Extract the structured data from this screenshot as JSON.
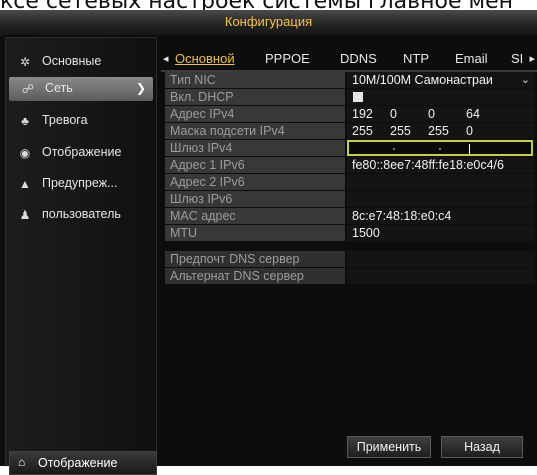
{
  "caption": "ксе сетевых настроек системы главное мен",
  "window": {
    "title": "Конфигурация"
  },
  "sidebar": {
    "items": [
      {
        "icon": "gear-icon",
        "glyph": "✲",
        "label": "Основные"
      },
      {
        "icon": "network-icon",
        "glyph": "☍",
        "label": "Сеть",
        "active": true
      },
      {
        "icon": "alarm-icon",
        "glyph": "♣",
        "label": "Тревога"
      },
      {
        "icon": "eye-icon",
        "glyph": "◉",
        "label": "Отображение"
      },
      {
        "icon": "warning-icon",
        "glyph": "▲",
        "label": "Предупреж..."
      },
      {
        "icon": "users-icon",
        "glyph": "♟",
        "label": "пользователь"
      }
    ],
    "bottom": {
      "icon": "home-icon",
      "glyph": "⌂",
      "label": "Отображение"
    }
  },
  "tabs": [
    "Основной",
    "PPPOE",
    "DDNS",
    "NTP",
    "Email",
    "SI"
  ],
  "form": {
    "nic_type": {
      "label": "Тип NIC",
      "value": "10M/100M Самонастраи"
    },
    "dhcp": {
      "label": "Вкл. DHCP"
    },
    "ipv4": {
      "label": "Адрес IPv4",
      "octets": [
        "192",
        "0",
        "0",
        "64"
      ]
    },
    "mask": {
      "label": "Маска подсети IPv4",
      "octets": [
        "255",
        "255",
        "255",
        "0"
      ]
    },
    "gateway": {
      "label": "Шлюз IPv4"
    },
    "ipv6_1": {
      "label": "Адрес 1 IPv6",
      "value": "fe80::8ee7:48ff:fe18:e0c4/6"
    },
    "ipv6_2": {
      "label": "Адрес 2 IPv6",
      "value": ""
    },
    "gw6": {
      "label": "Шлюз IPv6",
      "value": ""
    },
    "mac": {
      "label": "MAC адрес",
      "value": "8c:e7:48:18:e0:c4"
    },
    "mtu": {
      "label": "MTU",
      "value": "1500"
    },
    "dns_pref": {
      "label": "Предпочт DNS сервер"
    },
    "dns_alt": {
      "label": "Альтернат DNS сервер"
    }
  },
  "buttons": {
    "apply": "Применить",
    "back": "Назад"
  },
  "colors": {
    "accent": "#f1c232",
    "focus": "#c3d23a",
    "title": "#f5c342"
  }
}
